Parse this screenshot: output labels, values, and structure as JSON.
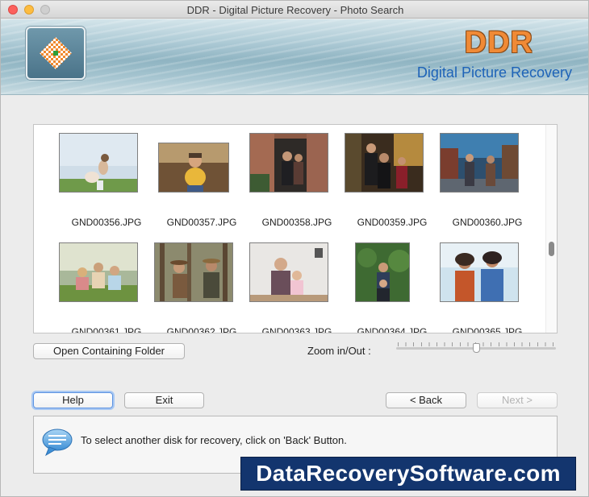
{
  "window": {
    "title": "DDR - Digital Picture Recovery - Photo Search"
  },
  "banner": {
    "brand": "DDR",
    "product": "Digital Picture Recovery",
    "logo_icon": "checkered-diamond-logo-icon"
  },
  "gallery": {
    "items": [
      {
        "name": "GND00356.JPG"
      },
      {
        "name": "GND00357.JPG"
      },
      {
        "name": "GND00358.JPG"
      },
      {
        "name": "GND00359.JPG"
      },
      {
        "name": "GND00360.JPG"
      },
      {
        "name": "GND00361.JPG"
      },
      {
        "name": "GND00362.JPG"
      },
      {
        "name": "GND00363.JPG"
      },
      {
        "name": "GND00364.JPG"
      },
      {
        "name": "GND00365.JPG"
      }
    ]
  },
  "toolbar": {
    "open_folder_label": "Open Containing Folder",
    "zoom_label": "Zoom in/Out :",
    "zoom_level": 0.5
  },
  "buttons": {
    "help": "Help",
    "exit": "Exit",
    "back": "< Back",
    "next": "Next >"
  },
  "info": {
    "message": "To select another disk for recovery, click on 'Back' Button.",
    "icon": "speech-bubble-icon"
  },
  "watermark": {
    "text": "DataRecoverySoftware.com"
  },
  "colors": {
    "brand_orange": "#f08a36",
    "product_blue": "#1e63b8",
    "watermark_bg": "#13356e",
    "focus_blue": "#5c93e2"
  }
}
